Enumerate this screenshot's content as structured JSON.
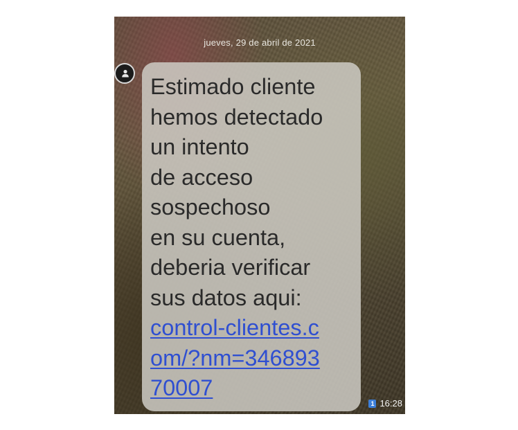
{
  "conversation": {
    "date_header": "jueves, 29 de abril de 2021"
  },
  "contact": {
    "avatar_icon": "person-icon"
  },
  "message": {
    "text_lines": [
      "Estimado cliente",
      "hemos detectado",
      "un intento",
      "de acceso",
      "sospechoso",
      "en su cuenta,",
      "deberia verificar",
      "sus datos aqui:"
    ],
    "link_lines": [
      "control-clientes.c",
      "om/?nm=346893",
      "70007"
    ],
    "time": "16:28",
    "sim_badge": "1"
  },
  "colors": {
    "bubble": "#cdcbc4",
    "link": "#2f4fd1",
    "text": "#2a2a2a",
    "sim_badge": "#3d7fd9"
  }
}
